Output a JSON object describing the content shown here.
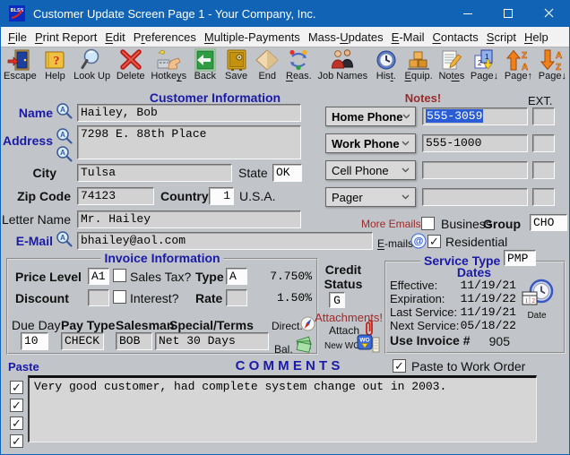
{
  "window": {
    "title": "Customer Update Screen Page 1 - Your Company, Inc."
  },
  "menu": [
    {
      "pre": "",
      "key": "F",
      "post": "ile"
    },
    {
      "pre": "",
      "key": "P",
      "post": "rint Report"
    },
    {
      "pre": "",
      "key": "E",
      "post": "dit"
    },
    {
      "pre": "P",
      "key": "r",
      "post": "eferences"
    },
    {
      "pre": "",
      "key": "M",
      "post": "ultiple-Payments"
    },
    {
      "pre": "Mass-",
      "key": "U",
      "post": "pdates"
    },
    {
      "pre": "",
      "key": "E",
      "post": "-Mail"
    },
    {
      "pre": "",
      "key": "C",
      "post": "ontacts"
    },
    {
      "pre": "",
      "key": "S",
      "post": "cript"
    },
    {
      "pre": "",
      "key": "H",
      "post": "elp"
    }
  ],
  "toolbar": [
    {
      "pre": "Escape",
      "key": "",
      "post": "",
      "icon": "door-icon"
    },
    {
      "pre": "Help",
      "key": "",
      "post": "",
      "icon": "help-book-icon"
    },
    {
      "pre": "Look Up",
      "key": "",
      "post": "",
      "icon": "magnifier-icon"
    },
    {
      "pre": "Delete",
      "key": "",
      "post": "",
      "icon": "red-x-icon"
    },
    {
      "pre": "Hotke",
      "key": "y",
      "post": "s",
      "icon": "hotkeys-hand-icon"
    },
    {
      "pre": "Back",
      "key": "",
      "post": "",
      "icon": "back-arrow-icon"
    },
    {
      "pre": "Save",
      "key": "",
      "post": "",
      "icon": "safe-icon"
    },
    {
      "pre": "End",
      "key": "",
      "post": "",
      "icon": "end-diamond-icon"
    },
    {
      "pre": "",
      "key": "R",
      "post": "eas.",
      "icon": "recycle-arrows-icon"
    },
    {
      "pre": "Job Names",
      "key": "",
      "post": "",
      "icon": "people-icon"
    },
    {
      "pre": "His",
      "key": "t",
      "post": ".",
      "icon": "history-clock-icon"
    },
    {
      "pre": "",
      "key": "E",
      "post": "quip.",
      "icon": "equipment-boxes-icon"
    },
    {
      "pre": "No",
      "key": "te",
      "post": "s",
      "icon": "notes-pad-icon"
    },
    {
      "pre": "Page↓",
      "key": "",
      "post": "",
      "icon": "pages-12-down-icon"
    },
    {
      "pre": "Page↑",
      "key": "",
      "post": "",
      "icon": "sort-za-up-icon"
    },
    {
      "pre": "Page↓",
      "key": "",
      "post": "",
      "icon": "sort-az-down-icon"
    }
  ],
  "customer": {
    "header": "Customer Information",
    "name_label": "Name",
    "name_value": "Hailey, Bob",
    "address_label": "Address",
    "address_value": "7298 E. 88th Place",
    "city_label": "City",
    "city_value": "Tulsa",
    "state_label": "State",
    "state_value": "OK",
    "zip_label": "Zip Code",
    "zip_value": "74123",
    "country_label": "Country",
    "country_value": "1",
    "country_name": "U.S.A.",
    "letter_label": "Letter Name",
    "letter_value": "Mr. Hailey",
    "email_label": "E-Mail",
    "email_value": "bhailey@aol.com"
  },
  "phones": {
    "notes_label": "Notes!",
    "ext_label": "EXT.",
    "rows": [
      {
        "label": "Home Phone",
        "value": "555-3059",
        "ext": "",
        "selected": true
      },
      {
        "label": "Work Phone",
        "value": "555-1000",
        "ext": "",
        "selected": false
      },
      {
        "label": "Cell Phone",
        "value": "",
        "ext": "",
        "selected": false
      },
      {
        "label": "Pager",
        "value": "",
        "ext": "",
        "selected": false
      }
    ]
  },
  "emails": {
    "more_label": "More Emails",
    "business_label": "Business",
    "business_checked": false,
    "group_label": "Group",
    "group_value": "CHO",
    "emails_key": "E",
    "emails_post": "-mails",
    "residential_label": "Residential",
    "residential_checked": true
  },
  "invoice": {
    "header": "Invoice Information",
    "price_label": "Price Level",
    "price_value": "A1",
    "sales_tax_label": "Sales Tax?",
    "sales_tax_checked": false,
    "type_label": "Type",
    "type_value": "A",
    "tax_rate": "7.750%",
    "discount_label": "Discount",
    "discount_value": "",
    "interest_label": "Interest?",
    "interest_checked": false,
    "rate_label": "Rate",
    "rate_value": "",
    "interest_rate": "1.50%",
    "due_day_label": "Due Day",
    "due_day_value": "10",
    "pay_type_label": "Pay Type",
    "pay_type_value": "CHECK",
    "salesman_label": "Salesman",
    "salesman_value": "BOB",
    "special_label": "Special/Terms",
    "special_value": "Net 30 Days",
    "direct_label": "Direct.",
    "bal_label": "Bal."
  },
  "credit": {
    "label_line1": "Credit",
    "label_line2": "Status",
    "value": "G",
    "attachments_label": "Attachments!",
    "attach_label": "Attach",
    "new_wo_label": "New WO"
  },
  "service": {
    "header": "Service Type",
    "type_value": "PMP",
    "dates_label": "Dates",
    "rows": [
      {
        "label": "Effective:",
        "value": "11/19/21"
      },
      {
        "label": "Expiration:",
        "value": "11/19/22"
      },
      {
        "label": "Last Service:",
        "value": "11/19/21"
      },
      {
        "label": "Next Service:",
        "value": "05/18/22"
      }
    ],
    "use_invoice_label": "Use Invoice #",
    "invoice_number": "905",
    "date_icon_label": "Date"
  },
  "comments": {
    "paste_label": "Paste",
    "header": "C O M M E N T S",
    "paste_to_wo_label": "Paste to Work Order",
    "paste_to_wo_checked": true,
    "row_checks": [
      true,
      true,
      true,
      true
    ],
    "text": "Very good customer, had complete system change out in 2003."
  },
  "colors": {
    "title_bar": "#1063b5",
    "label_blue": "#1a1aa8",
    "alert_maroon": "#9b2b2b",
    "selection": "#2a5cd6",
    "window_bg": "#c1c4c8"
  }
}
